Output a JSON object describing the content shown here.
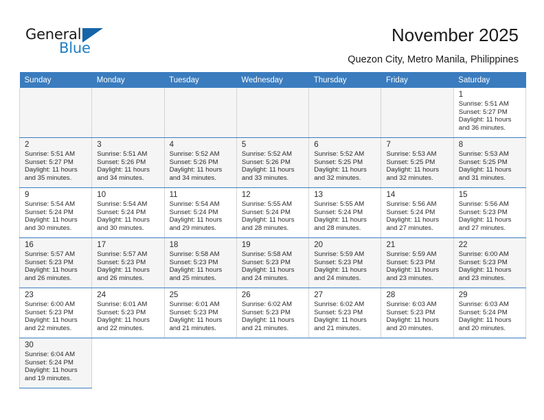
{
  "logo": {
    "word_top": "General",
    "word_bottom": "Blue",
    "triangle": "blue-triangle-icon",
    "accent_dark": "#1565a8",
    "accent_light": "#1e7fc4"
  },
  "header": {
    "title": "November 2025",
    "subtitle": "Quezon City, Metro Manila, Philippines"
  },
  "colors": {
    "header_bg": "#3a7cbe",
    "header_text": "#ffffff",
    "row_shade": "#f5f5f5",
    "cell_border": "#d4d4d4",
    "row_divider": "#3a7cbe"
  },
  "weekday_headers": [
    "Sunday",
    "Monday",
    "Tuesday",
    "Wednesday",
    "Thursday",
    "Friday",
    "Saturday"
  ],
  "weeks": [
    {
      "shaded": false,
      "days": [
        {
          "num": "",
          "info": ""
        },
        {
          "num": "",
          "info": ""
        },
        {
          "num": "",
          "info": ""
        },
        {
          "num": "",
          "info": ""
        },
        {
          "num": "",
          "info": ""
        },
        {
          "num": "",
          "info": ""
        },
        {
          "num": "1",
          "info": "Sunrise: 5:51 AM\nSunset: 5:27 PM\nDaylight: 11 hours\nand 36 minutes."
        }
      ]
    },
    {
      "shaded": true,
      "days": [
        {
          "num": "2",
          "info": "Sunrise: 5:51 AM\nSunset: 5:27 PM\nDaylight: 11 hours\nand 35 minutes."
        },
        {
          "num": "3",
          "info": "Sunrise: 5:51 AM\nSunset: 5:26 PM\nDaylight: 11 hours\nand 34 minutes."
        },
        {
          "num": "4",
          "info": "Sunrise: 5:52 AM\nSunset: 5:26 PM\nDaylight: 11 hours\nand 34 minutes."
        },
        {
          "num": "5",
          "info": "Sunrise: 5:52 AM\nSunset: 5:26 PM\nDaylight: 11 hours\nand 33 minutes."
        },
        {
          "num": "6",
          "info": "Sunrise: 5:52 AM\nSunset: 5:25 PM\nDaylight: 11 hours\nand 32 minutes."
        },
        {
          "num": "7",
          "info": "Sunrise: 5:53 AM\nSunset: 5:25 PM\nDaylight: 11 hours\nand 32 minutes."
        },
        {
          "num": "8",
          "info": "Sunrise: 5:53 AM\nSunset: 5:25 PM\nDaylight: 11 hours\nand 31 minutes."
        }
      ]
    },
    {
      "shaded": false,
      "days": [
        {
          "num": "9",
          "info": "Sunrise: 5:54 AM\nSunset: 5:24 PM\nDaylight: 11 hours\nand 30 minutes."
        },
        {
          "num": "10",
          "info": "Sunrise: 5:54 AM\nSunset: 5:24 PM\nDaylight: 11 hours\nand 30 minutes."
        },
        {
          "num": "11",
          "info": "Sunrise: 5:54 AM\nSunset: 5:24 PM\nDaylight: 11 hours\nand 29 minutes."
        },
        {
          "num": "12",
          "info": "Sunrise: 5:55 AM\nSunset: 5:24 PM\nDaylight: 11 hours\nand 28 minutes."
        },
        {
          "num": "13",
          "info": "Sunrise: 5:55 AM\nSunset: 5:24 PM\nDaylight: 11 hours\nand 28 minutes."
        },
        {
          "num": "14",
          "info": "Sunrise: 5:56 AM\nSunset: 5:24 PM\nDaylight: 11 hours\nand 27 minutes."
        },
        {
          "num": "15",
          "info": "Sunrise: 5:56 AM\nSunset: 5:23 PM\nDaylight: 11 hours\nand 27 minutes."
        }
      ]
    },
    {
      "shaded": true,
      "days": [
        {
          "num": "16",
          "info": "Sunrise: 5:57 AM\nSunset: 5:23 PM\nDaylight: 11 hours\nand 26 minutes."
        },
        {
          "num": "17",
          "info": "Sunrise: 5:57 AM\nSunset: 5:23 PM\nDaylight: 11 hours\nand 26 minutes."
        },
        {
          "num": "18",
          "info": "Sunrise: 5:58 AM\nSunset: 5:23 PM\nDaylight: 11 hours\nand 25 minutes."
        },
        {
          "num": "19",
          "info": "Sunrise: 5:58 AM\nSunset: 5:23 PM\nDaylight: 11 hours\nand 24 minutes."
        },
        {
          "num": "20",
          "info": "Sunrise: 5:59 AM\nSunset: 5:23 PM\nDaylight: 11 hours\nand 24 minutes."
        },
        {
          "num": "21",
          "info": "Sunrise: 5:59 AM\nSunset: 5:23 PM\nDaylight: 11 hours\nand 23 minutes."
        },
        {
          "num": "22",
          "info": "Sunrise: 6:00 AM\nSunset: 5:23 PM\nDaylight: 11 hours\nand 23 minutes."
        }
      ]
    },
    {
      "shaded": false,
      "days": [
        {
          "num": "23",
          "info": "Sunrise: 6:00 AM\nSunset: 5:23 PM\nDaylight: 11 hours\nand 22 minutes."
        },
        {
          "num": "24",
          "info": "Sunrise: 6:01 AM\nSunset: 5:23 PM\nDaylight: 11 hours\nand 22 minutes."
        },
        {
          "num": "25",
          "info": "Sunrise: 6:01 AM\nSunset: 5:23 PM\nDaylight: 11 hours\nand 21 minutes."
        },
        {
          "num": "26",
          "info": "Sunrise: 6:02 AM\nSunset: 5:23 PM\nDaylight: 11 hours\nand 21 minutes."
        },
        {
          "num": "27",
          "info": "Sunrise: 6:02 AM\nSunset: 5:23 PM\nDaylight: 11 hours\nand 21 minutes."
        },
        {
          "num": "28",
          "info": "Sunrise: 6:03 AM\nSunset: 5:23 PM\nDaylight: 11 hours\nand 20 minutes."
        },
        {
          "num": "29",
          "info": "Sunrise: 6:03 AM\nSunset: 5:24 PM\nDaylight: 11 hours\nand 20 minutes."
        }
      ]
    },
    {
      "shaded": true,
      "days": [
        {
          "num": "30",
          "info": "Sunrise: 6:04 AM\nSunset: 5:24 PM\nDaylight: 11 hours\nand 19 minutes."
        },
        {
          "num": "",
          "info": ""
        },
        {
          "num": "",
          "info": ""
        },
        {
          "num": "",
          "info": ""
        },
        {
          "num": "",
          "info": ""
        },
        {
          "num": "",
          "info": ""
        },
        {
          "num": "",
          "info": ""
        }
      ]
    }
  ]
}
